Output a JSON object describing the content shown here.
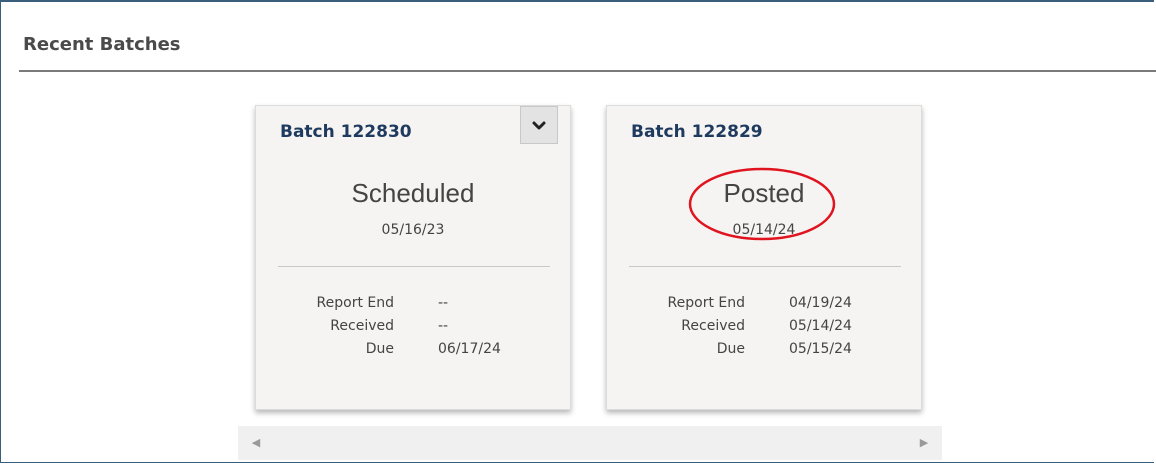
{
  "panel": {
    "title": "Recent Batches"
  },
  "batches": [
    {
      "title": "Batch 122830",
      "status": "Scheduled",
      "status_date": "05/16/23",
      "menu_icon": "chevron-down-icon",
      "details": [
        {
          "label": "Report End",
          "value": "--"
        },
        {
          "label": "Received",
          "value": "--"
        },
        {
          "label": "Due",
          "value": "06/17/24"
        }
      ]
    },
    {
      "title": "Batch 122829",
      "status": "Posted",
      "status_date": "05/14/24",
      "details": [
        {
          "label": "Report End",
          "value": "04/19/24"
        },
        {
          "label": "Received",
          "value": "05/14/24"
        },
        {
          "label": "Due",
          "value": "05/15/24"
        }
      ]
    }
  ],
  "colors": {
    "title": "#1f3a5f",
    "card_bg": "#f5f4f2",
    "annotation_ring": "#e0141e"
  },
  "scrollbar": {
    "left_icon": "left-arrow-icon",
    "right_icon": "right-arrow-icon"
  }
}
